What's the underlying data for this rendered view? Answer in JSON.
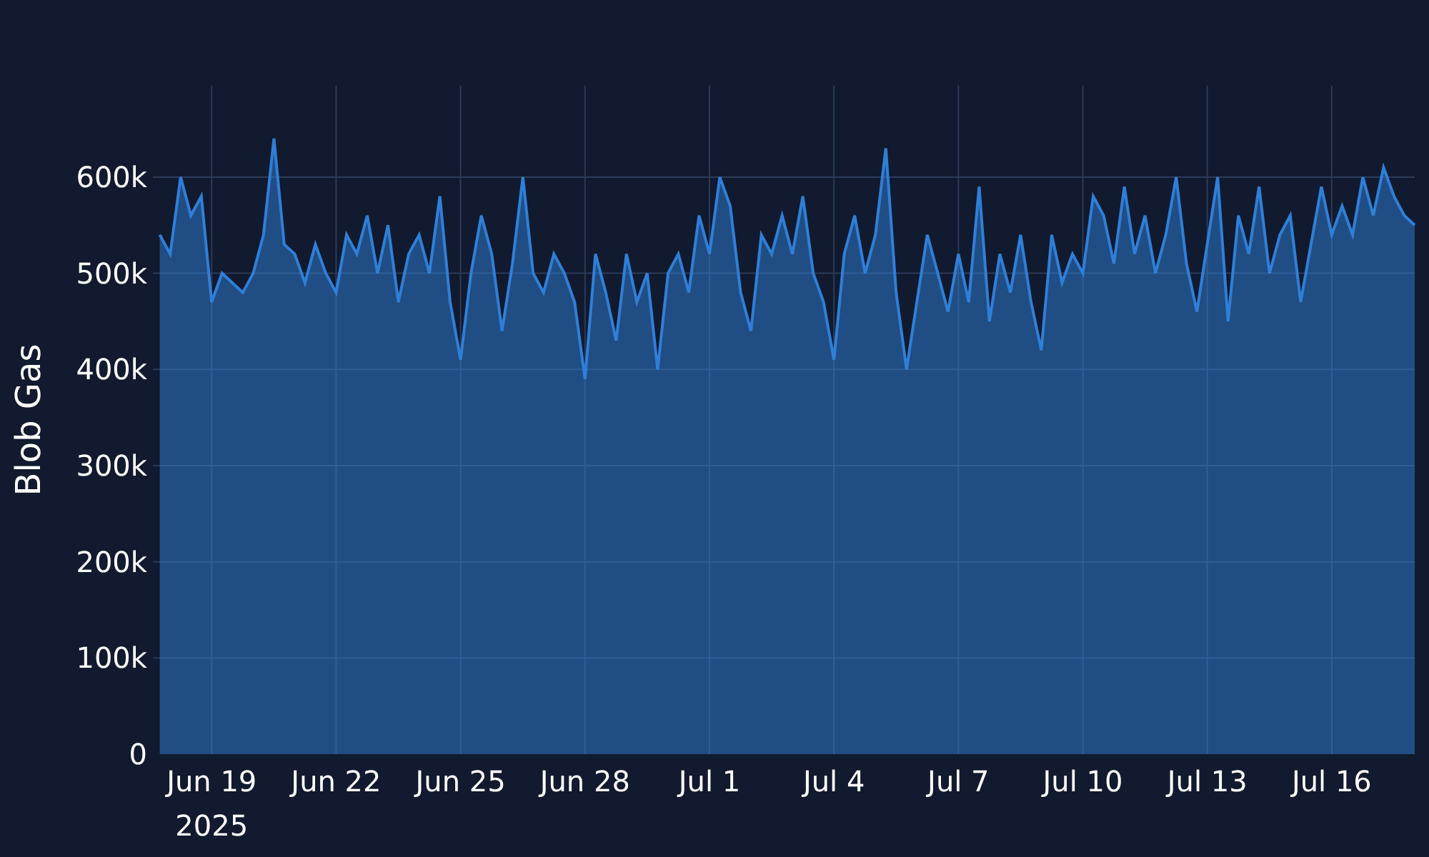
{
  "chart_data": {
    "type": "area",
    "grid": true,
    "ylabel": "Blob Gas",
    "xlim": [
      "2025-06-17T14:00",
      "2025-07-18T00:00"
    ],
    "ylim": [
      0,
      695000
    ],
    "yticks": [
      {
        "value": 0,
        "label": "0"
      },
      {
        "value": 100000,
        "label": "100k"
      },
      {
        "value": 200000,
        "label": "200k"
      },
      {
        "value": 300000,
        "label": "300k"
      },
      {
        "value": 400000,
        "label": "400k"
      },
      {
        "value": 500000,
        "label": "500k"
      },
      {
        "value": 600000,
        "label": "600k"
      }
    ],
    "xticks": [
      {
        "value": "2025-06-19T00:00",
        "label": "Jun 19\n2025"
      },
      {
        "value": "2025-06-22T00:00",
        "label": "Jun 22"
      },
      {
        "value": "2025-06-25T00:00",
        "label": "Jun 25"
      },
      {
        "value": "2025-06-28T00:00",
        "label": "Jun 28"
      },
      {
        "value": "2025-07-01T00:00",
        "label": "Jul 1"
      },
      {
        "value": "2025-07-04T00:00",
        "label": "Jul 4"
      },
      {
        "value": "2025-07-07T00:00",
        "label": "Jul 7"
      },
      {
        "value": "2025-07-10T00:00",
        "label": "Jul 10"
      },
      {
        "value": "2025-07-13T00:00",
        "label": "Jul 13"
      },
      {
        "value": "2025-07-16T00:00",
        "label": "Jul 16"
      }
    ],
    "x": [
      "2025-06-17T18:00",
      "2025-06-18T00:00",
      "2025-06-18T06:00",
      "2025-06-18T12:00",
      "2025-06-18T18:00",
      "2025-06-19T00:00",
      "2025-06-19T06:00",
      "2025-06-19T12:00",
      "2025-06-19T18:00",
      "2025-06-20T00:00",
      "2025-06-20T06:00",
      "2025-06-20T12:00",
      "2025-06-20T18:00",
      "2025-06-21T00:00",
      "2025-06-21T06:00",
      "2025-06-21T12:00",
      "2025-06-21T18:00",
      "2025-06-22T00:00",
      "2025-06-22T06:00",
      "2025-06-22T12:00",
      "2025-06-22T18:00",
      "2025-06-23T00:00",
      "2025-06-23T06:00",
      "2025-06-23T12:00",
      "2025-06-23T18:00",
      "2025-06-24T00:00",
      "2025-06-24T06:00",
      "2025-06-24T12:00",
      "2025-06-24T18:00",
      "2025-06-25T00:00",
      "2025-06-25T06:00",
      "2025-06-25T12:00",
      "2025-06-25T18:00",
      "2025-06-26T00:00",
      "2025-06-26T06:00",
      "2025-06-26T12:00",
      "2025-06-26T18:00",
      "2025-06-27T00:00",
      "2025-06-27T06:00",
      "2025-06-27T12:00",
      "2025-06-27T18:00",
      "2025-06-28T00:00",
      "2025-06-28T06:00",
      "2025-06-28T12:00",
      "2025-06-28T18:00",
      "2025-06-29T00:00",
      "2025-06-29T06:00",
      "2025-06-29T12:00",
      "2025-06-29T18:00",
      "2025-06-30T00:00",
      "2025-06-30T06:00",
      "2025-06-30T12:00",
      "2025-06-30T18:00",
      "2025-07-01T00:00",
      "2025-07-01T06:00",
      "2025-07-01T12:00",
      "2025-07-01T18:00",
      "2025-07-02T00:00",
      "2025-07-02T06:00",
      "2025-07-02T12:00",
      "2025-07-02T18:00",
      "2025-07-03T00:00",
      "2025-07-03T06:00",
      "2025-07-03T12:00",
      "2025-07-03T18:00",
      "2025-07-04T00:00",
      "2025-07-04T06:00",
      "2025-07-04T12:00",
      "2025-07-04T18:00",
      "2025-07-05T00:00",
      "2025-07-05T06:00",
      "2025-07-05T12:00",
      "2025-07-05T18:00",
      "2025-07-06T00:00",
      "2025-07-06T06:00",
      "2025-07-06T12:00",
      "2025-07-06T18:00",
      "2025-07-07T00:00",
      "2025-07-07T06:00",
      "2025-07-07T12:00",
      "2025-07-07T18:00",
      "2025-07-08T00:00",
      "2025-07-08T06:00",
      "2025-07-08T12:00",
      "2025-07-08T18:00",
      "2025-07-09T00:00",
      "2025-07-09T06:00",
      "2025-07-09T12:00",
      "2025-07-09T18:00",
      "2025-07-10T00:00",
      "2025-07-10T06:00",
      "2025-07-10T12:00",
      "2025-07-10T18:00",
      "2025-07-11T00:00",
      "2025-07-11T06:00",
      "2025-07-11T12:00",
      "2025-07-11T18:00",
      "2025-07-12T00:00",
      "2025-07-12T06:00",
      "2025-07-12T12:00",
      "2025-07-12T18:00",
      "2025-07-13T00:00",
      "2025-07-13T06:00",
      "2025-07-13T12:00",
      "2025-07-13T18:00",
      "2025-07-14T00:00",
      "2025-07-14T06:00",
      "2025-07-14T12:00",
      "2025-07-14T18:00",
      "2025-07-15T00:00",
      "2025-07-15T06:00",
      "2025-07-15T12:00",
      "2025-07-15T18:00",
      "2025-07-16T00:00",
      "2025-07-16T06:00",
      "2025-07-16T12:00",
      "2025-07-16T18:00",
      "2025-07-17T00:00",
      "2025-07-17T06:00",
      "2025-07-17T12:00",
      "2025-07-17T18:00",
      "2025-07-18T00:00"
    ],
    "series": [
      {
        "color": "#2f7fd8",
        "values": [
          540000,
          520000,
          600000,
          560000,
          580000,
          470000,
          500000,
          490000,
          480000,
          500000,
          540000,
          640000,
          530000,
          520000,
          490000,
          530000,
          500000,
          480000,
          540000,
          520000,
          560000,
          500000,
          550000,
          470000,
          520000,
          540000,
          500000,
          580000,
          470000,
          410000,
          500000,
          560000,
          520000,
          440000,
          510000,
          600000,
          500000,
          480000,
          520000,
          500000,
          470000,
          390000,
          520000,
          480000,
          430000,
          520000,
          470000,
          500000,
          400000,
          500000,
          520000,
          480000,
          560000,
          520000,
          600000,
          570000,
          480000,
          440000,
          540000,
          520000,
          560000,
          520000,
          580000,
          500000,
          470000,
          410000,
          520000,
          560000,
          500000,
          540000,
          630000,
          480000,
          400000,
          470000,
          540000,
          500000,
          460000,
          520000,
          470000,
          590000,
          450000,
          520000,
          480000,
          540000,
          470000,
          420000,
          540000,
          490000,
          520000,
          500000,
          580000,
          560000,
          510000,
          590000,
          520000,
          560000,
          500000,
          540000,
          600000,
          510000,
          460000,
          530000,
          600000,
          450000,
          560000,
          520000,
          590000,
          500000,
          540000,
          560000,
          470000,
          530000,
          590000,
          540000,
          570000,
          540000,
          600000,
          560000,
          610000,
          580000,
          560000,
          550000
        ]
      }
    ]
  }
}
